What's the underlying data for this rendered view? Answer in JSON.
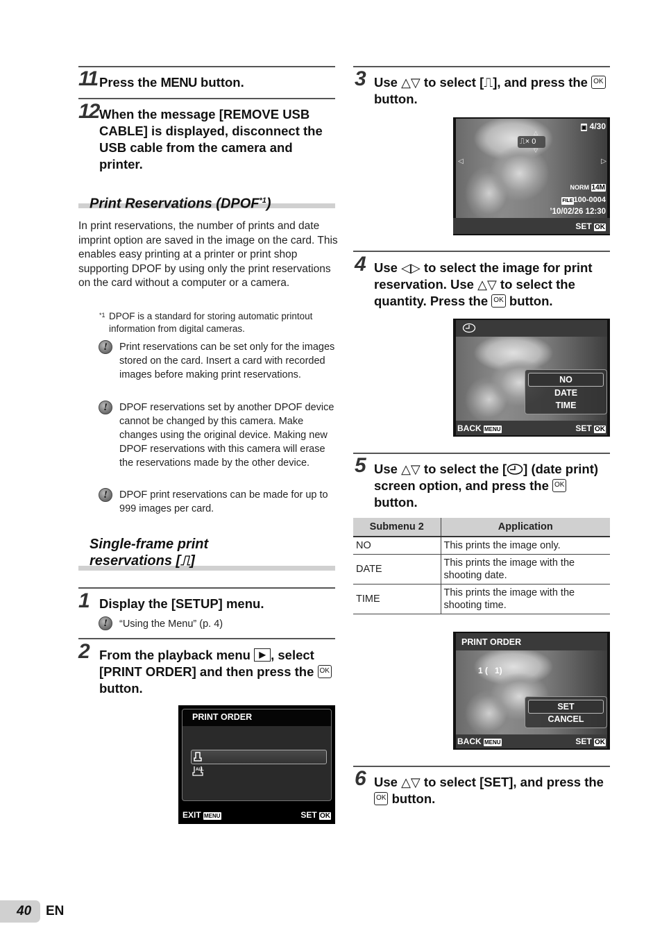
{
  "left": {
    "step11": {
      "num": "11",
      "text_pre": "Press the ",
      "text_menu": "MENU",
      "text_post": " button."
    },
    "step12": {
      "num": "12",
      "text": "When the message [REMOVE USB CABLE] is displayed, disconnect the USB cable from the camera and printer."
    },
    "section_dpof": {
      "title": "Print Reservations (DPOF",
      "title_sup": "*1",
      "title_end": ")",
      "body": "In print reservations, the number of prints and date imprint option are saved in the image on the card. This enables easy printing at a printer or print shop supporting DPOF by using only the print reservations on the card without a computer or a camera.",
      "footnote_mark": "*1",
      "footnote": "DPOF is a standard for storing automatic printout information from digital cameras.",
      "notes": [
        "Print reservations can be set only for the images stored on the card. Insert a card with recorded images before making print reservations.",
        "DPOF reservations set by another DPOF device cannot be changed by this camera. Make changes using the original device. Making new DPOF reservations with this camera will erase the reservations made by the other device.",
        "DPOF print reservations can be made for up to 999 images per card."
      ]
    },
    "section_single": {
      "title_line1": "Single-frame print",
      "title_line2": "reservations [",
      "title_icon": "⎍",
      "title_end": "]"
    },
    "step1": {
      "num": "1",
      "text": "Display the [SETUP] menu.",
      "note": "“Using the Menu” (p. 4)"
    },
    "step2": {
      "num": "2",
      "text_pre": "From the playback menu ",
      "play_icon": "▶",
      "text_mid": ", select [PRINT ORDER] and then press the ",
      "ok": "OK",
      "text_post": " button."
    },
    "screen_print_order": {
      "title": "PRINT ORDER",
      "items": [
        {
          "icon": "print-single-icon",
          "selected": true
        },
        {
          "icon": "print-all-icon",
          "label": "ALL",
          "selected": false
        }
      ],
      "footer_left": "EXIT",
      "footer_left_key": "MENU",
      "footer_right": "SET",
      "footer_right_key": "OK"
    }
  },
  "right": {
    "step3": {
      "num": "3",
      "text_pre": "Use ",
      "arrows": "△▽",
      "text_mid": " to select [",
      "icon": "⎍",
      "text_mid2": "], and press the ",
      "ok": "OK",
      "text_post": " button."
    },
    "screen_playback": {
      "counter_icon": "card-icon",
      "counter": "4/30",
      "print_count_label": "×",
      "print_count": "0",
      "quality": "NORM",
      "size": "14M",
      "file_label": "FILE",
      "file_number": "100-0004",
      "datetime": "’10/02/26  12:30",
      "footer_right": "SET",
      "footer_right_key": "OK"
    },
    "step4": {
      "num": "4",
      "text_pre": "Use ",
      "arrows_lr": "◁▷",
      "text_mid": " to select the image for print reservation. Use ",
      "arrows_ud": "△▽",
      "text_mid2": " to select the quantity. Press the ",
      "ok": "OK",
      "text_post": " button."
    },
    "screen_dateprint": {
      "header_icon": "date-print-icon",
      "options": [
        "NO",
        "DATE",
        "TIME"
      ],
      "selected_index": 0,
      "footer_left": "BACK",
      "footer_left_key": "MENU",
      "footer_right": "SET",
      "footer_right_key": "OK"
    },
    "step5": {
      "num": "5",
      "text_pre": "Use ",
      "arrows": "△▽",
      "text_mid": " to select the [",
      "text_mid2": "] (date print) screen option, and press the ",
      "ok": "OK",
      "text_post": " button."
    },
    "table": {
      "headers": [
        "Submenu 2",
        "Application"
      ],
      "rows": [
        [
          "NO",
          "This prints the image only."
        ],
        [
          "DATE",
          "This prints the image with the shooting date."
        ],
        [
          "TIME",
          "This prints the image with the shooting time."
        ]
      ]
    },
    "screen_confirm": {
      "title": "PRINT ORDER",
      "count_text": "1 (   1)",
      "options": [
        "SET",
        "CANCEL"
      ],
      "selected_index": 0,
      "footer_left": "BACK",
      "footer_left_key": "MENU",
      "footer_right": "SET",
      "footer_right_key": "OK"
    },
    "step6": {
      "num": "6",
      "text_pre": "Use ",
      "arrows": "△▽",
      "text_mid": " to select [SET], and press the ",
      "ok": "OK",
      "text_post": " button."
    }
  },
  "footer": {
    "page_number": "40",
    "language": "EN"
  }
}
